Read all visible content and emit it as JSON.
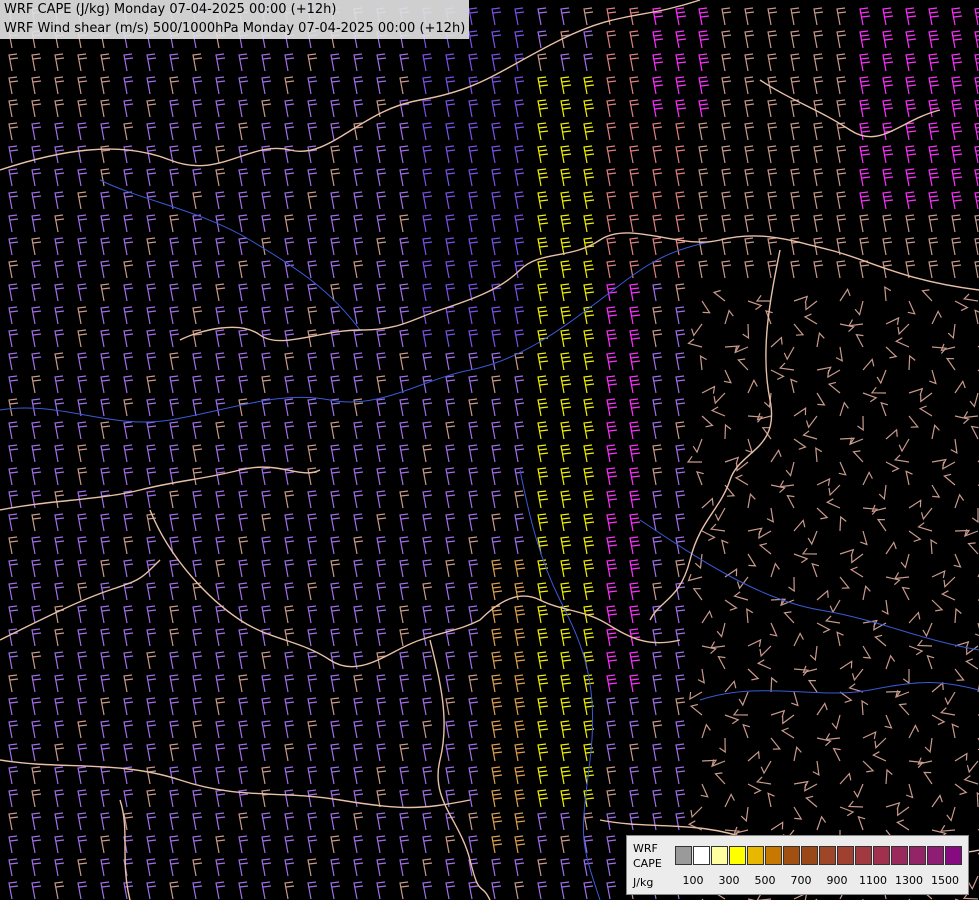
{
  "header": {
    "line1": "WRF CAPE (J/kg) Monday 07-04-2025 00:00 (+12h)",
    "line2": "WRF Wind shear (m/s) 500/1000hPa Monday 07-04-2025 00:00 (+12h)"
  },
  "legend": {
    "label1": "WRF",
    "label2": "CAPE",
    "label3": "J/kg",
    "colors": [
      "#9a9a9a",
      "#ffffff",
      "#ffffa0",
      "#ffff00",
      "#e8b800",
      "#c77800",
      "#a05010",
      "#9a4818",
      "#9e4628",
      "#a04030",
      "#a03a40",
      "#a0304e",
      "#9a2a5c",
      "#942468",
      "#8e1e74",
      "#860a80"
    ],
    "ticks": [
      "100",
      "300",
      "500",
      "700",
      "900",
      "1100",
      "1300",
      "1500"
    ]
  },
  "map": {
    "barb_colors": {
      "low": "#c89a8c",
      "violet": "#a070e8",
      "purple": "#7a52e8",
      "yellow": "#f2f200",
      "orange": "#e0a050",
      "pink": "#ff30ff",
      "salmon": "#e08080"
    },
    "border_color": "#e8c0a8",
    "river_color": "#3a5ad8"
  }
}
